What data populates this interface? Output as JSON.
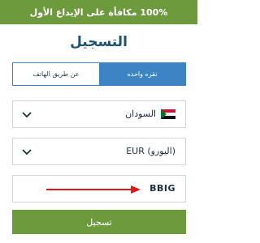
{
  "banner": {
    "text": "100% مكافأة على الإيداع الأول"
  },
  "title": "التسجيل",
  "tabs": [
    {
      "label": "عن طريق الهاتف",
      "active": false
    },
    {
      "label": "نقره واحده",
      "active": true
    }
  ],
  "country": {
    "value": "السودان",
    "flag": "sudan-flag"
  },
  "currency": {
    "value": "EUR (اليورو)"
  },
  "promo": {
    "value": "BBIG"
  },
  "submit_label": "تسجيل",
  "colors": {
    "brand_green": "#6e9a3e",
    "accent_blue": "#3d84c4",
    "title_blue": "#1d5172",
    "arrow_red": "#e0161b"
  }
}
